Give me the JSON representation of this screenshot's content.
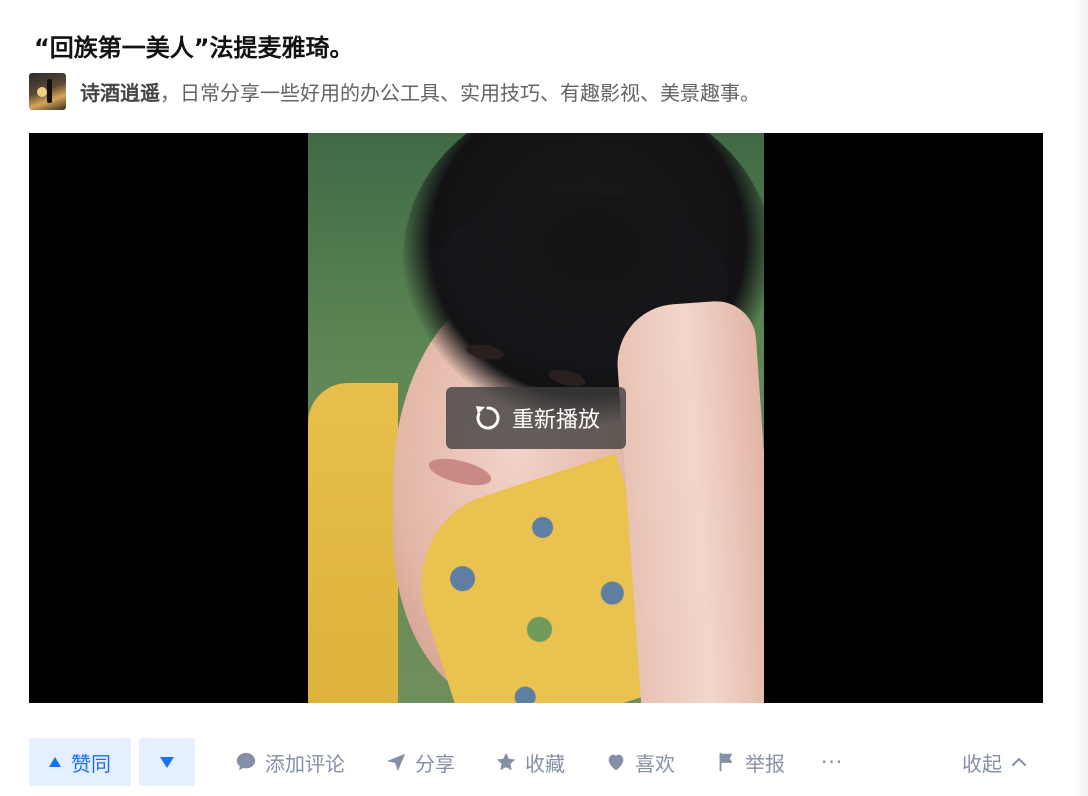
{
  "post": {
    "title": "“回族第一美人”法提麦雅琦。",
    "author_name": "诗酒逍遥",
    "author_bio": "，日常分享一些好用的办公工具、实用技巧、有趣影视、美景趣事。"
  },
  "video": {
    "replay_label": "重新播放"
  },
  "actions": {
    "upvote_label": "赞同",
    "comment_label": "添加评论",
    "share_label": "分享",
    "favorite_label": "收藏",
    "like_label": "喜欢",
    "report_label": "举报",
    "more_label": "···",
    "collapse_label": "收起"
  },
  "icons": {
    "upvote": "triangle-up-icon",
    "downvote": "triangle-down-icon",
    "comment": "comment-bubble-icon",
    "share": "paper-plane-icon",
    "favorite": "star-icon",
    "like": "heart-icon",
    "report": "flag-icon",
    "collapse": "chevron-up-icon",
    "replay": "replay-icon"
  },
  "colors": {
    "accent": "#1772f6",
    "accent_bg": "#e5efff",
    "muted": "#8590a6"
  }
}
